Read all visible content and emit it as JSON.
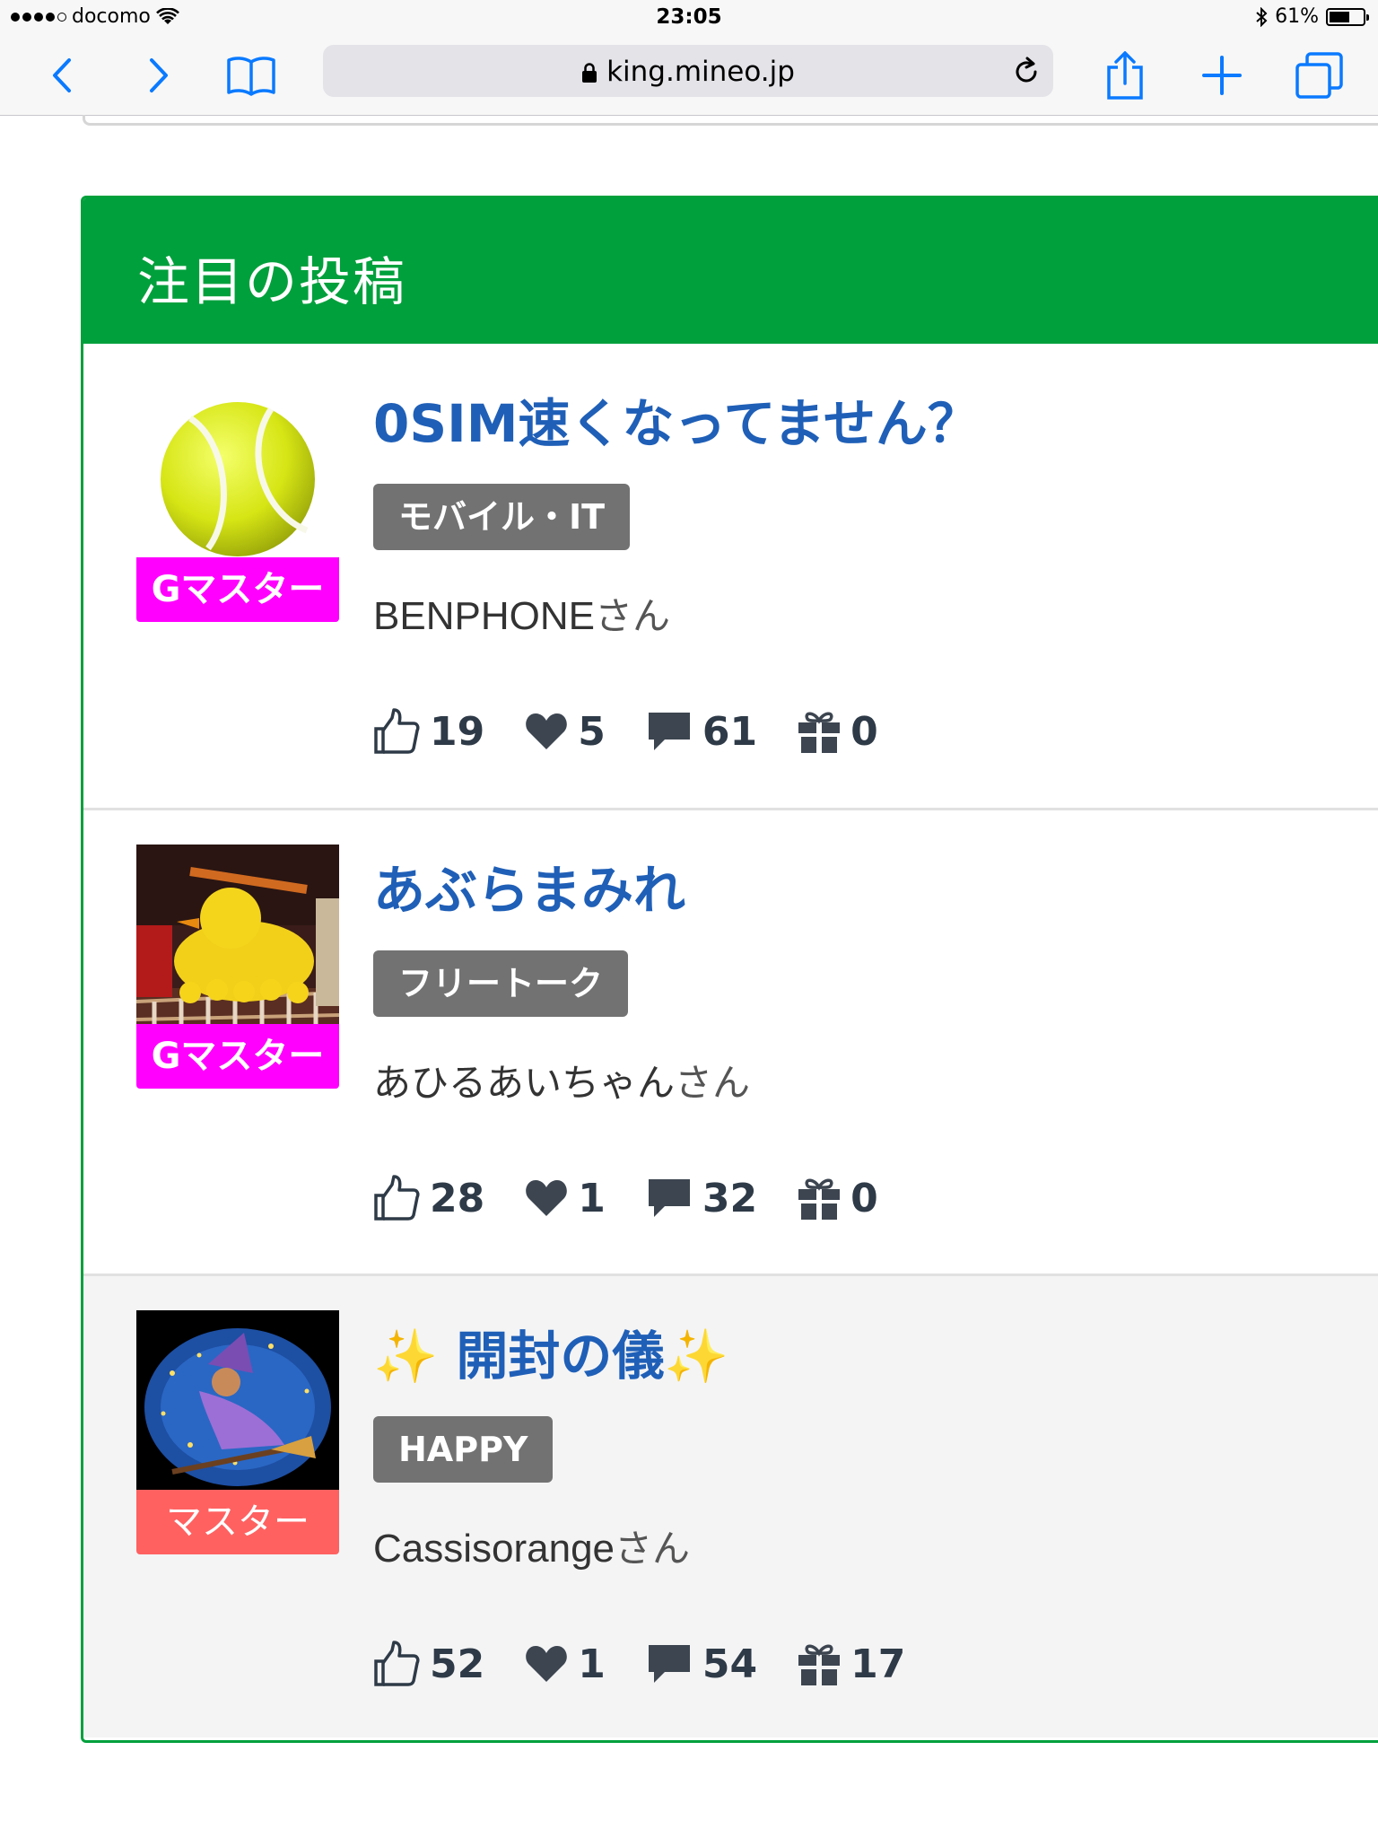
{
  "status_bar": {
    "carrier": "docomo",
    "time": "23:05",
    "battery": "61%",
    "battery_level": 0.61
  },
  "browser": {
    "url": "king.mineo.jp",
    "icons": [
      "back-icon",
      "forward-icon",
      "bookmarks-icon",
      "lock-icon",
      "reload-icon",
      "share-icon",
      "new-tab-icon",
      "tabs-icon"
    ]
  },
  "section": {
    "title": "注目の投稿"
  },
  "posts": [
    {
      "title": "0SIM速くなってません？",
      "category": "モバイル・IT",
      "rank": "Gマスター",
      "author": "BENPHONE",
      "author_suffix": "さん",
      "likes": "19",
      "hearts": "5",
      "comments": "61",
      "gifts": "0",
      "avatar": "tennis-ball-image"
    },
    {
      "title": "あぶらまみれ",
      "category": "フリートーク",
      "rank": "Gマスター",
      "author": "あひるあいちゃん",
      "author_suffix": "さん",
      "likes": "28",
      "hearts": "1",
      "comments": "32",
      "gifts": "0",
      "avatar": "rubber-ducks-image"
    },
    {
      "title_sparkle_left": "✨",
      "title": " 開封の儀",
      "title_sparkle_right": "✨",
      "category": "HAPPY",
      "rank": "マスター",
      "author": "Cassisorange",
      "author_suffix": "さん",
      "likes": "52",
      "hearts": "1",
      "comments": "54",
      "gifts": "17",
      "avatar": "witch-image"
    }
  ],
  "colors": {
    "accent_green": "#00a03c",
    "title_blue": "#1f5fb7",
    "g_master": "#ff00ff",
    "master": "#ff6161",
    "tag_gray": "#727272",
    "ios_blue": "#0a7aff"
  }
}
